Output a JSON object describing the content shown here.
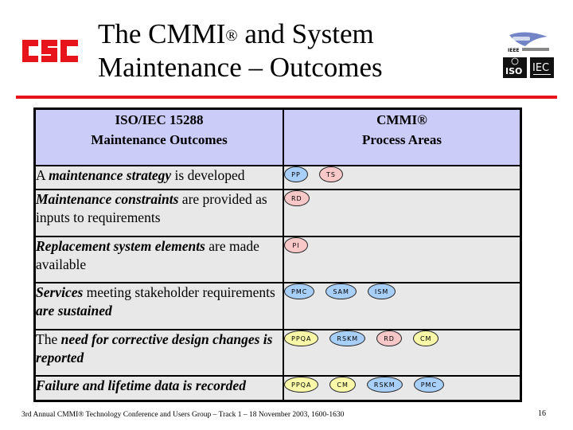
{
  "slide": {
    "title_line1": "The CMMI",
    "title_reg": "®",
    "title_line1_rest": " and System",
    "title_line2": "Maintenance – Outcomes",
    "logo_left": "CSC",
    "logos_right": [
      "IEEE Computer Society",
      "ISO",
      "IEC"
    ]
  },
  "table": {
    "header_left_line1": "ISO/IEC 15288",
    "header_left_line2": "Maintenance Outcomes",
    "header_right_line1": "CMMI®",
    "header_right_line2": "Process Areas",
    "rows": [
      {
        "outcome": [
          {
            "t": "A ",
            "b": false
          },
          {
            "t": "maintenance strategy",
            "b": true
          },
          {
            "t": " is developed",
            "b": false
          }
        ],
        "process_areas": [
          {
            "label": "PP",
            "color": "blue"
          },
          {
            "label": "TS",
            "color": "pink"
          }
        ]
      },
      {
        "outcome": [
          {
            "t": "Maintenance constraints",
            "b": true
          },
          {
            "t": " are provided as inputs to requirements",
            "b": false
          }
        ],
        "process_areas": [
          {
            "label": "RD",
            "color": "pink"
          }
        ]
      },
      {
        "outcome": [
          {
            "t": "Replacement system elements",
            "b": true
          },
          {
            "t": " are made available",
            "b": false
          }
        ],
        "process_areas": [
          {
            "label": "PI",
            "color": "pink"
          }
        ]
      },
      {
        "outcome": [
          {
            "t": "Services",
            "b": true
          },
          {
            "t": " meeting stakeholder requirements ",
            "b": false
          },
          {
            "t": "are sustained",
            "b": true
          }
        ],
        "process_areas": [
          {
            "label": "PMC",
            "color": "blue"
          },
          {
            "label": "SAM",
            "color": "blue"
          },
          {
            "label": "ISM",
            "color": "blue"
          }
        ]
      },
      {
        "outcome": [
          {
            "t": "The ",
            "b": false
          },
          {
            "t": "need for corrective design changes is reported",
            "b": true
          }
        ],
        "process_areas": [
          {
            "label": "PPQA",
            "color": "yellow"
          },
          {
            "label": "RSKM",
            "color": "blue"
          },
          {
            "label": "RD",
            "color": "pink"
          },
          {
            "label": "CM",
            "color": "yellow"
          }
        ]
      },
      {
        "outcome": [
          {
            "t": "Failure and lifetime data is recorded",
            "b": true
          }
        ],
        "process_areas": [
          {
            "label": "PPQA",
            "color": "yellow"
          },
          {
            "label": "CM",
            "color": "yellow"
          },
          {
            "label": "RSKM",
            "color": "blue"
          },
          {
            "label": "PMC",
            "color": "blue"
          }
        ]
      }
    ]
  },
  "colors": {
    "accent_red": "#e8141b",
    "header_bg": "#ccccf8",
    "cell_bg": "#e8e8e8",
    "pa_blue": "#a8cff8",
    "pa_pink": "#f8c8c8",
    "pa_yellow": "#f8f8a8"
  },
  "footer": {
    "text": "3rd Annual CMMI® Technology Conference and Users Group – Track 1 – 18 November 2003, 1600-1630",
    "page_number": "16"
  }
}
